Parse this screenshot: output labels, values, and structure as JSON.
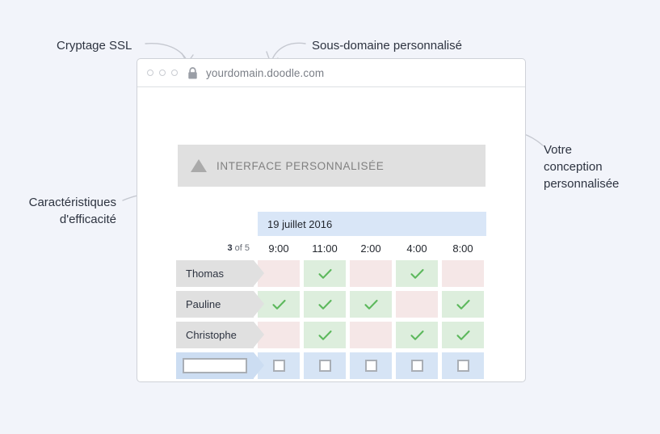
{
  "background_color": "#f2f4fa",
  "annotations": [
    {
      "id": "ssl",
      "text": "Cryptage SSL"
    },
    {
      "id": "subdomain",
      "text": "Sous-domaine personnalisé"
    },
    {
      "id": "design",
      "text": "Votre\nconception\npersonnalisée"
    },
    {
      "id": "efficacy",
      "text": "Caractéristiques\nd'efficacité"
    }
  ],
  "browser": {
    "window_dots": 3,
    "lock_icon": "padlock-icon",
    "url": "yourdomain.doodle.com"
  },
  "banner": {
    "logo_icon": "triangle-logo-icon",
    "title": "INTERFACE PERSONNALISÉE",
    "background": "#e0e0e0"
  },
  "poll": {
    "date_label": "19 juillet 2016",
    "date_band_color": "#d9e6f7",
    "count_value": "3",
    "count_suffix": "of 5",
    "times": [
      "9:00",
      "11:00",
      "2:00",
      "4:00",
      "8:00"
    ],
    "yes_color": "#ddeedd",
    "no_color": "#f5e7e7",
    "check_color": "#5cb85c",
    "input_row_color": "#d6e4f5",
    "participants": [
      {
        "name": "Thomas",
        "votes": [
          "no",
          "yes",
          "no",
          "yes",
          "no"
        ]
      },
      {
        "name": "Pauline",
        "votes": [
          "yes",
          "yes",
          "yes",
          "no",
          "yes"
        ]
      },
      {
        "name": "Christophe",
        "votes": [
          "no",
          "yes",
          "no",
          "yes",
          "yes"
        ]
      }
    ],
    "input_row": {
      "name_placeholder": "",
      "name_value": "",
      "checkboxes": [
        false,
        false,
        false,
        false,
        false
      ]
    }
  }
}
